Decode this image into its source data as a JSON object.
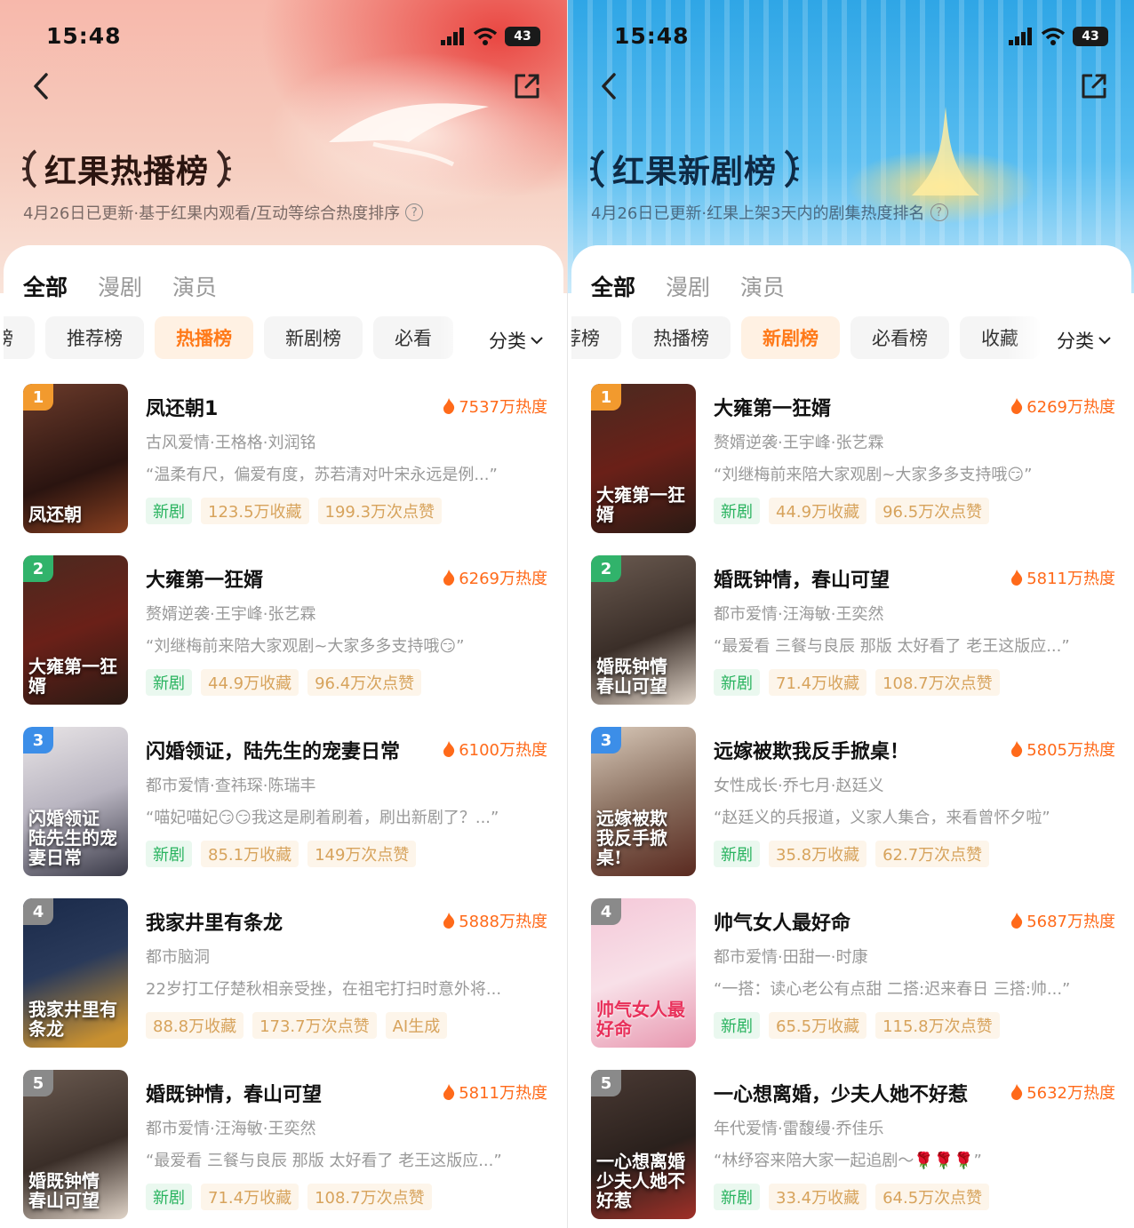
{
  "status": {
    "time": "15:48",
    "battery": "43"
  },
  "panels": [
    {
      "title": "红果热播榜",
      "subtitle": "4月26日已更新·基于红果内观看/互动等综合热度排序",
      "tabs": [
        "全部",
        "漫剧",
        "演员"
      ],
      "chips": [
        "总榜",
        "推荐榜",
        "热播榜",
        "新剧榜",
        "必看榜"
      ],
      "chip_labels": [
        "榜",
        "推荐榜",
        "热播榜",
        "新剧榜",
        "必看"
      ],
      "active_chip": "热播榜",
      "category": "分类",
      "items": [
        {
          "rank": "1",
          "name": "凤还朝1",
          "heat": "7537万热度",
          "meta": "古风爱情·王格格·刘润铭",
          "quote": "“温柔有尺，偏爱有度，苏若清对叶宋永远是例...”",
          "cover_text": "凤还朝",
          "tags": [
            "新剧",
            "123.5万收藏",
            "199.3万次点赞"
          ]
        },
        {
          "rank": "2",
          "name": "大雍第一狂婿",
          "heat": "6269万热度",
          "meta": "赘婿逆袭·王宇峰·张艺霖",
          "quote": "“刘继梅前来陪大家观剧~大家多多支持哦😏”",
          "cover_text": "大雍第一狂婿",
          "tags": [
            "新剧",
            "44.9万收藏",
            "96.4万次点赞"
          ]
        },
        {
          "rank": "3",
          "name": "闪婚领证，陆先生的宠妻日常",
          "heat": "6100万热度",
          "meta": "都市爱情·查祎琛·陈瑞丰",
          "quote": "“喵妃喵妃😏😏我这是刷着刷着，刷出新剧了？...”",
          "cover_text": "闪婚领证 陆先生的宠妻日常",
          "tags": [
            "新剧",
            "85.1万收藏",
            "149万次点赞"
          ]
        },
        {
          "rank": "4",
          "name": "我家井里有条龙",
          "heat": "5888万热度",
          "meta": "都市脑洞",
          "quote": "22岁打工仔楚秋相亲受挫，在祖宅打扫时意外将...",
          "cover_text": "我家井里有条龙",
          "tags": [
            "88.8万收藏",
            "173.7万次点赞",
            "AI生成"
          ]
        },
        {
          "rank": "5",
          "name": "婚既钟情，春山可望",
          "heat": "5811万热度",
          "meta": "都市爱情·汪海敏·王奕然",
          "quote": "“最爱看 三餐与良辰 那版 太好看了 老王这版应...”",
          "cover_text": "婚既钟情 春山可望",
          "tags": [
            "新剧",
            "71.4万收藏",
            "108.7万次点赞"
          ]
        }
      ]
    },
    {
      "title": "红果新剧榜",
      "subtitle": "4月26日已更新·红果上架3天内的剧集热度排名",
      "tabs": [
        "全部",
        "漫剧",
        "演员"
      ],
      "chip_labels": [
        "荐榜",
        "热播榜",
        "新剧榜",
        "必看榜",
        "收藏"
      ],
      "active_chip": "新剧榜",
      "category": "分类",
      "items": [
        {
          "rank": "1",
          "name": "大雍第一狂婿",
          "heat": "6269万热度",
          "meta": "赘婿逆袭·王宇峰·张艺霖",
          "quote": "“刘继梅前来陪大家观剧~大家多多支持哦😏”",
          "cover_text": "大雍第一狂婿",
          "tags": [
            "新剧",
            "44.9万收藏",
            "96.5万次点赞"
          ]
        },
        {
          "rank": "2",
          "name": "婚既钟情，春山可望",
          "heat": "5811万热度",
          "meta": "都市爱情·汪海敏·王奕然",
          "quote": "“最爱看 三餐与良辰 那版 太好看了 老王这版应...”",
          "cover_text": "婚既钟情 春山可望",
          "tags": [
            "新剧",
            "71.4万收藏",
            "108.7万次点赞"
          ]
        },
        {
          "rank": "3",
          "name": "远嫁被欺我反手掀桌！",
          "heat": "5805万热度",
          "meta": "女性成长·乔七月·赵廷义",
          "quote": "“赵廷义的兵报道，义家人集合，来看曾怀夕啦”",
          "cover_text": "远嫁被欺 我反手掀桌!",
          "tags": [
            "新剧",
            "35.8万收藏",
            "62.7万次点赞"
          ]
        },
        {
          "rank": "4",
          "name": "帅气女人最好命",
          "heat": "5687万热度",
          "meta": "都市爱情·田甜一·时康",
          "quote": "“一搭：读心老公有点甜 二搭:迟来春日 三搭:帅...”",
          "cover_text": "帅气女人最好命",
          "tags": [
            "新剧",
            "65.5万收藏",
            "115.8万次点赞"
          ]
        },
        {
          "rank": "5",
          "name": "一心想离婚，少夫人她不好惹",
          "heat": "5632万热度",
          "meta": "年代爱情·雷馥缦·乔佳乐",
          "quote": "“林纾容来陪大家一起追剧～🌹🌹🌹”",
          "cover_text": "一心想离婚 少夫人她不好惹",
          "tags": [
            "新剧",
            "33.4万收藏",
            "64.5万次点赞"
          ]
        }
      ]
    }
  ],
  "colors": {
    "accent": "#ff7a1a",
    "heat": "#ff6a1a",
    "new_tag": "#29b35f",
    "stat_tag": "#d7a35c",
    "rank1": "#f29a2e",
    "rank2": "#31b36b",
    "rank3": "#3c8ee8",
    "rank_other": "#8a8a8a"
  }
}
